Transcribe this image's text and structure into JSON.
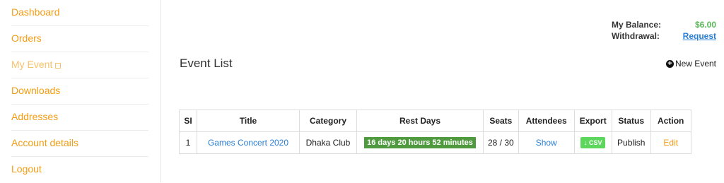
{
  "sidebar": {
    "items": [
      {
        "label": "Dashboard"
      },
      {
        "label": "Orders"
      },
      {
        "label": "My Event"
      },
      {
        "label": "Downloads"
      },
      {
        "label": "Addresses"
      },
      {
        "label": "Account details"
      },
      {
        "label": "Logout"
      }
    ]
  },
  "balance": {
    "balance_label": "My Balance:",
    "balance_value": "$6.00",
    "withdrawal_label": "Withdrawal:",
    "withdrawal_link": "Request"
  },
  "main": {
    "title": "Event List",
    "new_event_label": "New Event"
  },
  "table": {
    "headers": [
      "SI",
      "Title",
      "Category",
      "Rest Days",
      "Seats",
      "Attendees",
      "Export",
      "Status",
      "Action"
    ],
    "rows": [
      {
        "si": "1",
        "title": "Games Concert 2020",
        "category": "Dhaka Club",
        "rest_days": "16 days 20 hours 52 minutes",
        "seats": "28 / 30",
        "attendees": "Show",
        "export": "↓ CSV",
        "status": "Publish",
        "action": "Edit"
      }
    ]
  },
  "colors": {
    "accent": "#f39c12",
    "link": "#2a7fd4",
    "badge_green": "#4f9a3f",
    "csv_green": "#5cd65c"
  }
}
